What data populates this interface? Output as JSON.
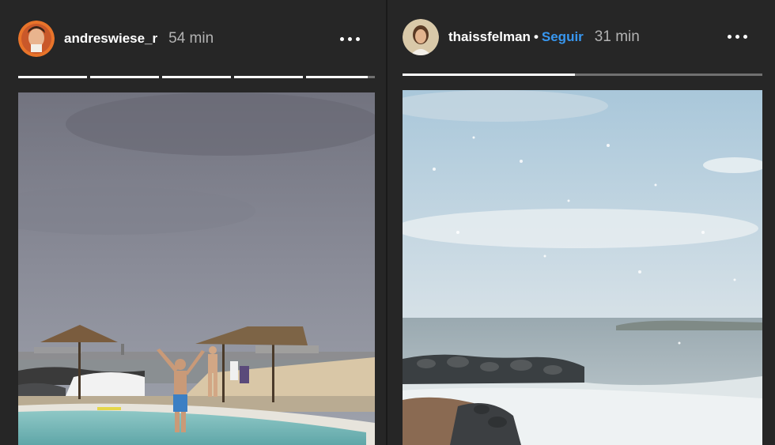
{
  "stories": [
    {
      "username": "andreswiese_r",
      "time": "54 min",
      "follow_label": "",
      "progress": [
        1,
        1,
        1,
        1,
        0.9
      ],
      "image_desc_icon": "beach-pool-photo"
    },
    {
      "username": "thaissfelman",
      "separator": "•",
      "follow_label": "Seguir",
      "time": "31 min",
      "progress": [
        0.48
      ]
    }
  ],
  "colors": {
    "background": "#262626",
    "follow": "#3897f0",
    "time": "#b3b3b3"
  }
}
